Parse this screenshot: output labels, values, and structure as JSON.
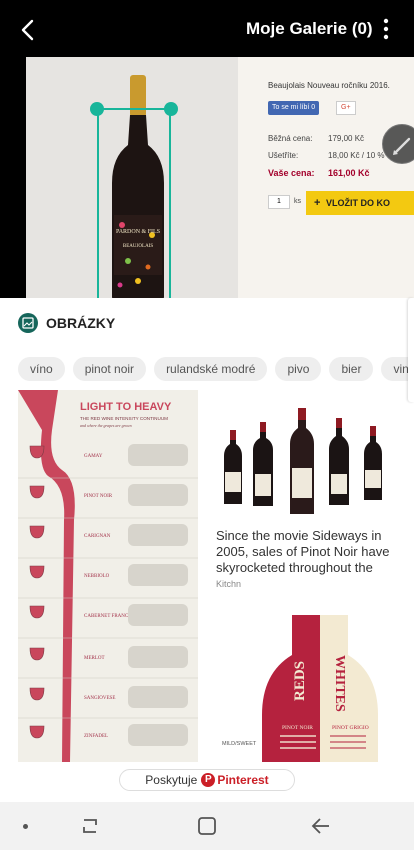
{
  "appbar": {
    "title": "Moje Galerie (0)"
  },
  "screenshot": {
    "product_name": "Beaujolais Nouveau ročníku 2016.",
    "like_label": "To se mi líbí 0",
    "gplus_label": "G+",
    "prices": [
      {
        "label": "Běžná cena:",
        "value": "179,00 Kč"
      },
      {
        "label": "Ušetříte:",
        "value": "18,00 Kč / 10 %"
      },
      {
        "label": "Vaše cena:",
        "value": "161,00 Kč"
      }
    ],
    "quantity": "1",
    "quantity_unit": "ks",
    "cart_label": "VLOŽIT DO KO",
    "bottle_label": "PARDON & FILS",
    "bottle_sublabel": "BEAUJOLAIS"
  },
  "panel": {
    "section_title": "OBRÁZKY",
    "chips": [
      "víno",
      "pinot noir",
      "rulandské modré",
      "pivo",
      "bier",
      "vino"
    ],
    "infographic": {
      "title_light": "LIGHT TO",
      "title_heavy": "HEAVY",
      "subtitle": "THE RED WINE INTENSITY CONTINUUM",
      "subsubtitle": "and where the grapes are grown",
      "grapes": [
        "GAMAY",
        "PINOT NOIR",
        "CARIGNAN",
        "NEBBIOLO",
        "CABERNET FRANC",
        "MERLOT",
        "SANGIOVESE",
        "ZINFADEL"
      ]
    },
    "caption": "Since the movie Sideways in 2005, sales of Pinot Noir have skyrocketed throughout the",
    "source": "Kitchn",
    "reds_whites": {
      "reds": "REDS",
      "whites": "WHITES",
      "pinot_noir": "PINOT NOIR",
      "pinot_grigio": "PINOT GRIGIO",
      "mild": "MILD/SWEET"
    },
    "provider_label": "Poskytuje",
    "provider_name": "Pinterest"
  },
  "colors": {
    "accent": "#18b59a",
    "price_red": "#a3002b",
    "pinterest": "#cb1f27",
    "cart_yellow": "#f3c911"
  }
}
